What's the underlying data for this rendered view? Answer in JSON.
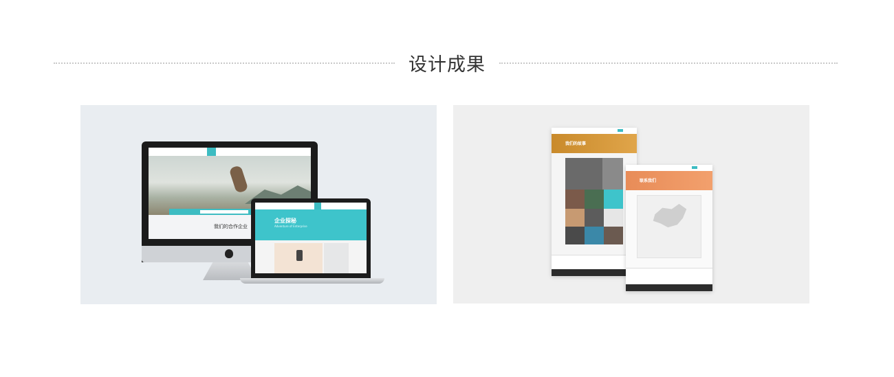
{
  "header": {
    "title": "设计成果"
  },
  "showcase": {
    "desktop_mockup": {
      "screen_heading": "我们的合作企业",
      "laptop_heading": "企业探秘",
      "laptop_subheading": "Adventure of Enterprise"
    },
    "mobile_pages": {
      "page1_heading": "我们的故事",
      "page2_heading": "联系我们"
    }
  },
  "colors": {
    "accent_teal": "#3ec4cb",
    "orange_story": "#d69a3a",
    "orange_contact": "#ec9461"
  }
}
